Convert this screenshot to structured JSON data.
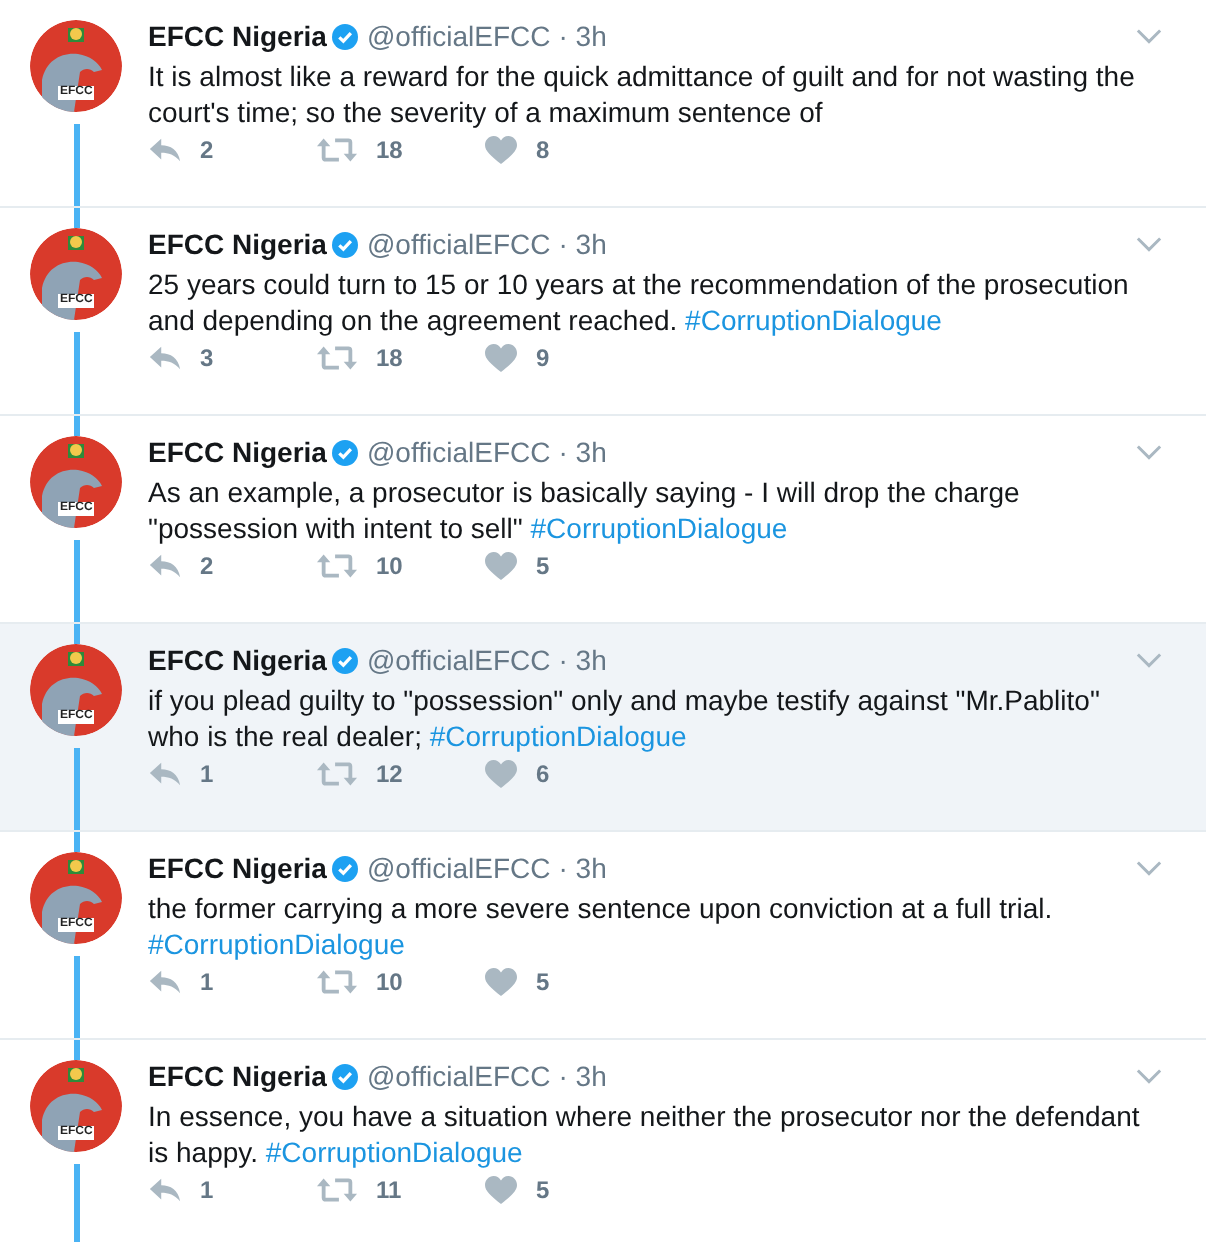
{
  "tweets": [
    {
      "avatar_label": "EFCC",
      "name": "EFCC Nigeria",
      "verified": true,
      "handle": "@officialEFCC",
      "time": "· 3h",
      "text": "It is almost like a reward for the quick admittance of guilt and for not wasting the court's time; so the severity of a maximum sentence of",
      "replies": "2",
      "retweets": "18",
      "likes": "8",
      "highlighted": false
    },
    {
      "avatar_label": "EFCC",
      "name": "EFCC Nigeria",
      "verified": true,
      "handle": "@officialEFCC",
      "time": "· 3h",
      "text": "25 years could turn to 15 or 10 years at the recommendation of the prosecution and depending on the agreement reached.",
      "hashtag": "#CorruptionDialogue",
      "replies": "3",
      "retweets": "18",
      "likes": "9",
      "highlighted": false
    },
    {
      "avatar_label": "EFCC",
      "name": "EFCC Nigeria",
      "verified": true,
      "handle": "@officialEFCC",
      "time": "· 3h",
      "text": "As an example, a prosecutor is basically saying - I will drop the charge \"possession with intent to sell\"",
      "hashtag": "#CorruptionDialogue",
      "replies": "2",
      "retweets": "10",
      "likes": "5",
      "highlighted": false
    },
    {
      "avatar_label": "EFCC",
      "name": "EFCC Nigeria",
      "verified": true,
      "handle": "@officialEFCC",
      "time": "· 3h",
      "text": "if you plead guilty to \"possession\" only and maybe testify against \"Mr.Pablito\" who is the real dealer;",
      "hashtag": "#CorruptionDialogue",
      "replies": "1",
      "retweets": "12",
      "likes": "6",
      "highlighted": true
    },
    {
      "avatar_label": "EFCC",
      "name": "EFCC Nigeria",
      "verified": true,
      "handle": "@officialEFCC",
      "time": "· 3h",
      "text": "the former carrying a more severe sentence upon conviction at a full trial.",
      "hashtag": "#CorruptionDialogue",
      "replies": "1",
      "retweets": "10",
      "likes": "5",
      "highlighted": false
    },
    {
      "avatar_label": "EFCC",
      "name": "EFCC Nigeria",
      "verified": true,
      "handle": "@officialEFCC",
      "time": "· 3h",
      "text": "In essence, you have a situation where neither the prosecutor nor the defendant is happy.",
      "hashtag": "#CorruptionDialogue",
      "replies": "1",
      "retweets": "11",
      "likes": "5",
      "highlighted": false
    }
  ]
}
